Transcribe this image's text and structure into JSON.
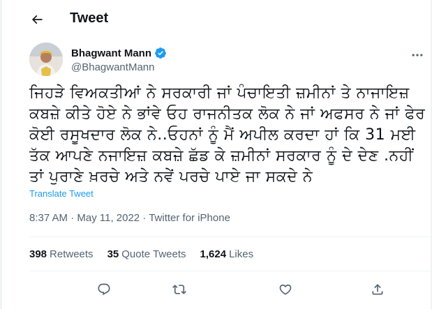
{
  "header": {
    "title": "Tweet",
    "back_icon": "arrow-left-icon"
  },
  "author": {
    "name": "Bhagwant Mann",
    "handle": "@BhagwantMann",
    "verified": true
  },
  "tweet": {
    "lines": [
      "ਜਿਹੜੇ ਵਿਅਕਤੀਆਂ ਨੇ ਸਰਕਾਰੀ ਜਾਂ ਪੰਚਾਇਤੀ ਜ਼ਮੀਨਾਂ ਤੇ ਨਾਜਾਇਜ਼",
      "ਕਬਜ਼ੇ ਕੀਤੇ ਹੋਏ ਨੇ ਭਾਂਵੇ ਓਹ ਰਾਜਨੀਤਕ ਲੋਕ ਨੇ ਜਾਂ ਅਫਸਰ ਨੇ ਜਾਂ ਫੇਰ",
      "ਕੋਈ ਰਸੂਖਦਾਰ ਲੋਕ ਨੇ..ਓਹਨਾਂ ਨੂੰ ਮੈਂ ਅਪੀਲ ਕਰਦਾ ਹਾਂ ਕਿ 31 ਮਈ",
      "ਤੱਕ ਆਪਣੇ ਨਜਾਇਜ਼ ਕਬਜ਼ੇ ਛੱਡ ਕੇ ਜ਼ਮੀਨਾਂ ਸਰਕਾਰ ਨੂੰ ਦੇ ਦੇਣ .ਨਹੀਂ",
      "ਤਾਂ ਪੁਰਾਣੇ ਖ਼ਰਚੇ ਅਤੇ ਨਵੇਂ ਪਰਚੇ ਪਾਏ ਜਾ ਸਕਦੇ ਨੇ"
    ],
    "translate_label": "Translate Tweet",
    "timestamp": "8:37 AM · May 11, 2022 · Twitter for iPhone"
  },
  "stats": {
    "retweets_count": "398",
    "retweets_label": "Retweets",
    "quotes_count": "35",
    "quotes_label": "Quote Tweets",
    "likes_count": "1,624",
    "likes_label": "Likes"
  },
  "colors": {
    "accent": "#1d9bf0",
    "secondary_text": "#536471",
    "divider": "#eff3f4"
  }
}
